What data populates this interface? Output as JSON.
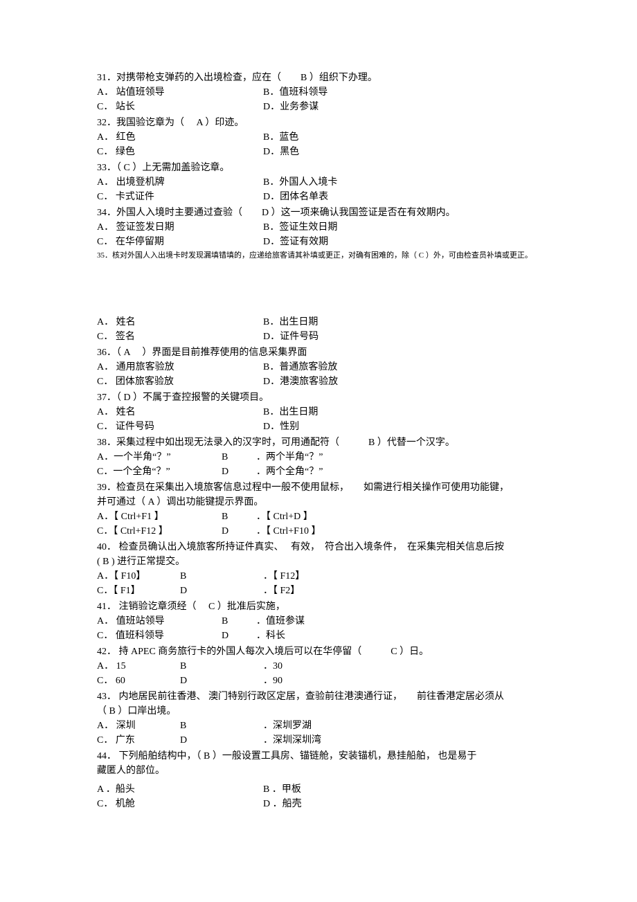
{
  "q31": {
    "stem": "31．对携带枪支弹药的入出境检查，应在（　　B ）组织下办理。",
    "a": "A． 站值班领导",
    "b": "B．值班科领导",
    "c": "C． 站长",
    "d": "D．业务参谋"
  },
  "q32": {
    "stem": "32．我国验讫章为（　 A ）印迹。",
    "a": "A． 红色",
    "b": "B．蓝色",
    "c": "C． 绿色",
    "d": "D．黑色"
  },
  "q33": {
    "stem": "33．（ C ）上无需加盖验讫章。",
    "a": "A． 出境登机牌",
    "b": "B．外国人入境卡",
    "c": "C． 卡式证件",
    "d": "D．团体名单表"
  },
  "q34": {
    "stem": "34．外国人入境时主要通过查验（　　D  ）这一项来确认我国签证是否在有效期内。",
    "a": "A． 签证签发日期",
    "b": "B．签证生效日期",
    "c": "C． 在华停留期",
    "d": "D．签证有效期"
  },
  "q35": {
    "stem": "35．核对外国人入出境卡时发现漏填错填的，应递给旅客请其补填或更正，对确有困难的，除（ C ）外，可由检查员补填或更正。",
    "a": "A． 姓名",
    "b": "B．出生日期",
    "c": "C． 签名",
    "d": "D．证件号码"
  },
  "q36": {
    "stem": "36．（ A　 ）界面是目前推荐使用的信息采集界面",
    "a": "A． 通用旅客验放",
    "b": "B．普通旅客验放",
    "c": "C． 团体旅客验放",
    "d": "D．港澳旅客验放"
  },
  "q37": {
    "stem": "37．（ D  ）不属于查控报警的关键项目。",
    "a": "A． 姓名",
    "b": "B．出生日期",
    "c": "C． 证件号码",
    "d": "D．性别"
  },
  "q38": {
    "stem": "38．采集过程中如出现无法录入的汉字时，可用通配符（　　　B  ）代替一个汉字。",
    "a": "A．一个半角“？”",
    "b": "B",
    "bt": "．两个半角“？”",
    "c": "C．一个全角“？”",
    "d": "D",
    "dt": "．两个全角“？”"
  },
  "q39": {
    "stem1": "39．检查员在采集出入境旅客信息过程中一般不使用鼠标，　　如需进行相关操作可使用功能键，",
    "stem2": "并可通过（  A  ）调出功能键提示界面。",
    "a": "A．【 Ctrl+F1 】",
    "b": "B",
    "bt": "．【 Ctrl+D 】",
    "c": "C．【 Ctrl+F12 】",
    "d": "D",
    "dt": "．【 Ctrl+F10  】"
  },
  "q40": {
    "stem1": "40． 检查员确认出入境旅客所持证件真实、　 有效，　符合出入境条件，　在采集完相关信息后按",
    "stem2": "( B )   进行正常提交。",
    "a": "A．【 F10】",
    "b": "B",
    "bt": "．【 F12】",
    "c": "C．【 F1】",
    "d": "D",
    "dt": "．【 F2】"
  },
  "q41": {
    "stem": "41． 注销验讫章须经（　 C  ）批准后实施，",
    "a": "A． 值班站领导",
    "b": "B",
    "bt": "．值班参谋",
    "c": "C． 值班科领导",
    "d": "D",
    "dt": "．科长"
  },
  "q42": {
    "stem": "42． 持 APEC 商务旅行卡的外国人每次入境后可以在华停留（　　　C ）日。",
    "a": "A．  15",
    "b": "B",
    "bt": "．30",
    "c": "C．  60",
    "d": "D",
    "dt": "．90"
  },
  "q43": {
    "stem1": "43． 内地居民前往香港、 澳门特别行政区定居，查验前往港澳通行证，　　前往香港定居必须从",
    "stem2": "（ B  ）口岸出境。",
    "a": "A． 深圳",
    "b": "B",
    "bt": "．深圳罗湖",
    "c": "C． 广东",
    "d": "D",
    "dt": "．深圳深圳湾"
  },
  "q44": {
    "stem1": "44． 下列船舶结构中，（ B ）一般设置工具房、锚链舱，安装锚机，悬挂船舶， 也是易于",
    "stem2": "藏匿人的部位。",
    "a": "A ．船头",
    "b": "B ．甲板",
    "c": "C． 机舱",
    "d": "D ．船壳"
  }
}
